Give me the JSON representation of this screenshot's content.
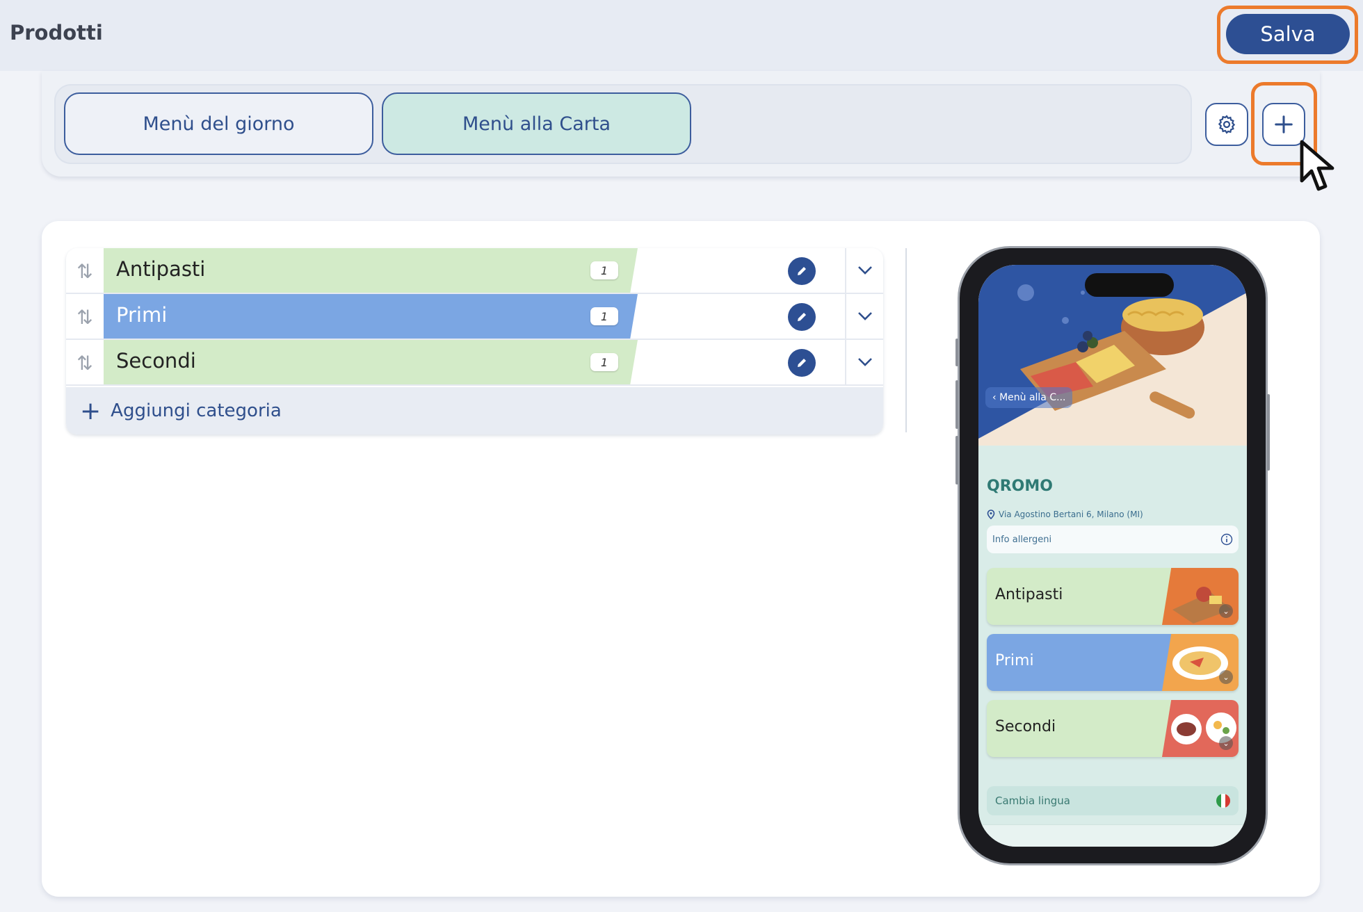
{
  "header": {
    "title": "Prodotti",
    "save_label": "Salva"
  },
  "tabs": [
    {
      "label": "Menù del giorno",
      "active": false
    },
    {
      "label": "Menù alla Carta",
      "active": true
    }
  ],
  "toolbar": {
    "settings_icon": "gear-icon",
    "add_icon": "plus-icon"
  },
  "categories": [
    {
      "name": "Antipasti",
      "count": "1",
      "color": "#d3ebc8"
    },
    {
      "name": "Primi",
      "count": "1",
      "color": "#7ba6e3"
    },
    {
      "name": "Secondi",
      "count": "1",
      "color": "#d3ebc8"
    }
  ],
  "add_category_label": "Aggiungi categoria",
  "preview": {
    "back_label": "Menù alla C...",
    "restaurant_name": "QROMO",
    "address": "Via Agostino Bertani 6, Milano (MI)",
    "allergen_info": "Info allergeni",
    "categories": [
      {
        "name": "Antipasti",
        "color": "#d3ebc8"
      },
      {
        "name": "Primi",
        "color": "#7ba6e3"
      },
      {
        "name": "Secondi",
        "color": "#d3ebc8"
      }
    ],
    "language_label": "Cambia lingua"
  },
  "colors": {
    "primary": "#2d4f93",
    "highlight": "#ec7a2b",
    "active_tab": "#cde9e3"
  }
}
